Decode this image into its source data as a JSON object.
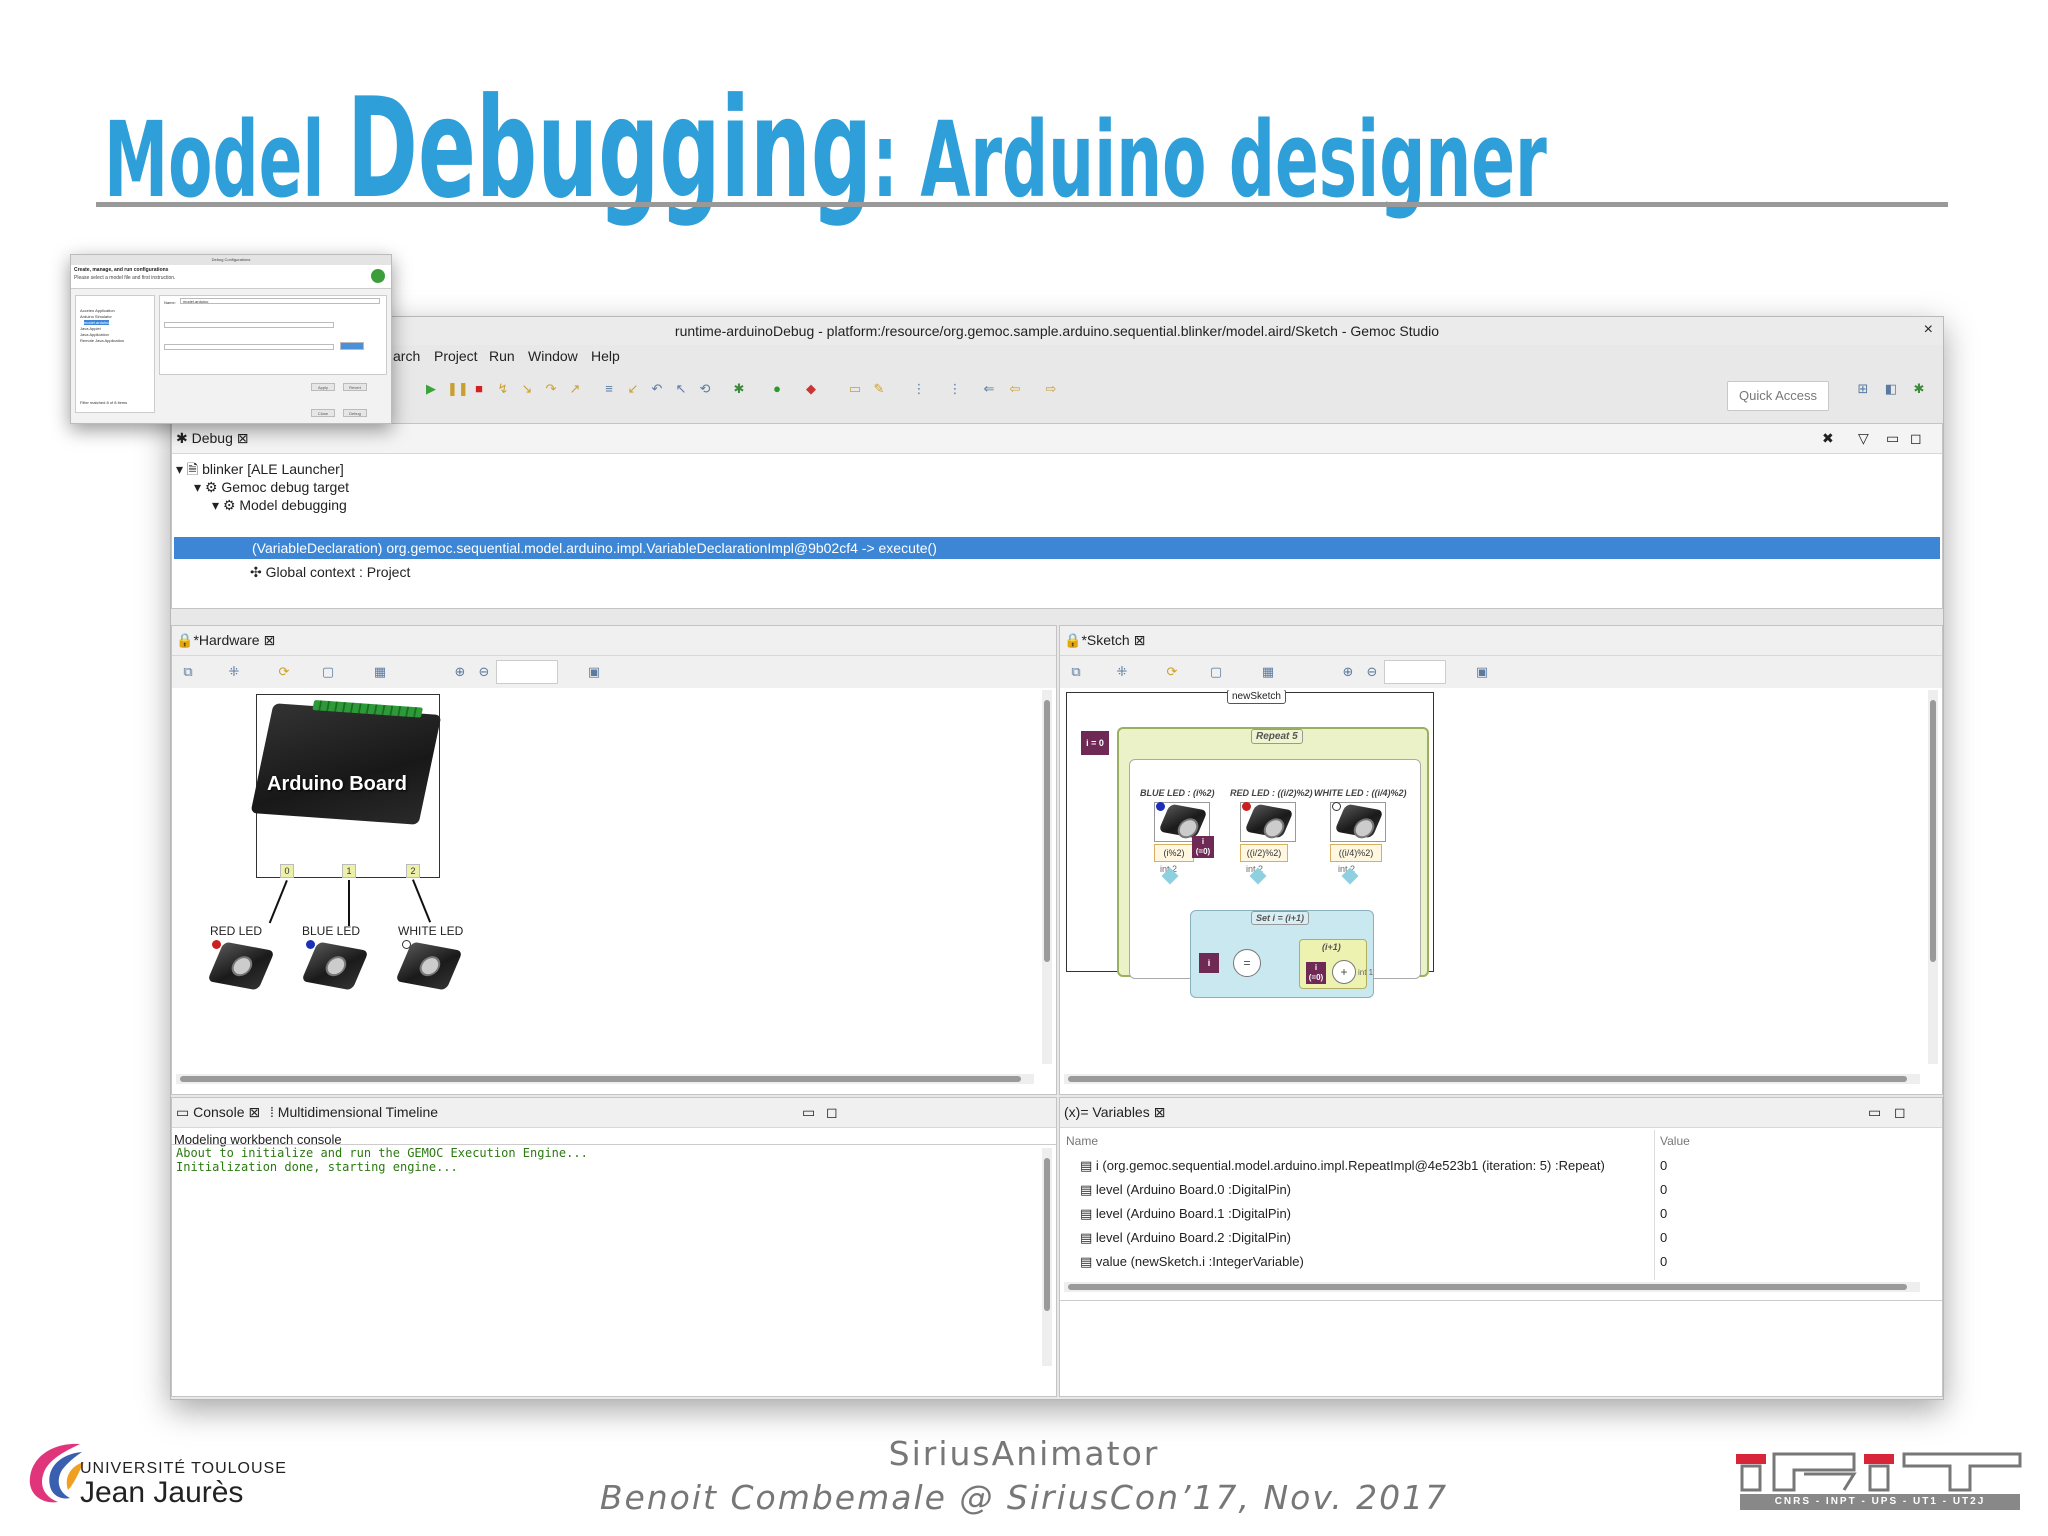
{
  "slide": {
    "title_part1": "Model ",
    "title_part2": "Debugging",
    "title_part3": ": Arduino designer",
    "footer_line1": "SiriusAnimator",
    "footer_line2": "Benoit Combemale @ SiriusCon’17, Nov. 2017",
    "accent_color": "#2e9fd8"
  },
  "window": {
    "title": "runtime-arduinoDebug - platform:/resource/org.gemoc.sample.arduino.sequential.blinker/model.aird/Sketch - Gemoc Studio",
    "close_glyph": "×",
    "menu": [
      "arch",
      "Project",
      "Run",
      "Window",
      "Help"
    ],
    "quick_access": "Quick Access"
  },
  "debug_view": {
    "tab_label": "Debug",
    "tree": [
      "blinker [ALE Launcher]",
      "Gemoc debug target",
      "Model debugging",
      "(VariableDeclaration) org.gemoc.sequential.model.arduino.impl.VariableDeclarationImpl@9b02cf4 -> execute()",
      "Global context : Project"
    ],
    "selection_color": "#3d86d6"
  },
  "hardware_view": {
    "tab_label": "*Hardware",
    "board_label": "Arduino Board",
    "pins": [
      "0",
      "1",
      "2"
    ],
    "leds": [
      {
        "label": "RED LED",
        "color": "#cc1f1f"
      },
      {
        "label": "BLUE LED",
        "color": "#1c2fb8"
      },
      {
        "label": "WHITE LED",
        "color": "#ffffff"
      }
    ]
  },
  "sketch_view": {
    "tab_label": "*Sketch",
    "sketch_name": "newSketch",
    "init_block": "i = 0",
    "repeat_label": "Repeat 5",
    "led_titles": [
      "BLUE LED : (i%2)",
      "RED LED : ((i/2)%2)",
      "WHITE LED : ((i/4)%2)"
    ],
    "led_exprs": [
      "(i%2)",
      "((i/2)%2)",
      "((i/4)%2)"
    ],
    "int_label": "int 2",
    "cond_block": "i\n(=0)",
    "set_label": "Set i = (i+1)",
    "set_var": "i",
    "assign_op": "=",
    "inc_label": "(i+1)",
    "inc_var": "i\n(=0)",
    "plus_op": "+",
    "inc_const": "int 1"
  },
  "console_view": {
    "tab_label": "Console",
    "tab2_label": "Multidimensional Timeline",
    "heading": "Modeling workbench console",
    "lines": "About to initialize and run the GEMOC Execution Engine...\nInitialization done, starting engine..."
  },
  "variables_view": {
    "tab_label": "Variables",
    "col_name": "Name",
    "col_value": "Value",
    "rows": [
      {
        "name": "i (org.gemoc.sequential.model.arduino.impl.RepeatImpl@4e523b1 (iteration: 5) :Repeat)",
        "value": "0"
      },
      {
        "name": "level (Arduino Board.0 :DigitalPin)",
        "value": "0"
      },
      {
        "name": "level (Arduino Board.1 :DigitalPin)",
        "value": "0"
      },
      {
        "name": "level (Arduino Board.2 :DigitalPin)",
        "value": "0"
      },
      {
        "name": "value (newSketch.i :IntegerVariable)",
        "value": "0"
      }
    ]
  },
  "dialog": {
    "title": "Debug Configurations",
    "heading": "Create, manage, and run configurations",
    "subheading": "Please select a model file and first instruction.",
    "name_label": "Name:",
    "name_value": "model.arduino",
    "tree_items": [
      "Acceleo Application",
      "Arduino Simulator",
      "model.arduino",
      "Java Applet",
      "Java Application",
      "Remote Java Application"
    ],
    "filter_text": "Filter matched 8 of 8 items",
    "buttons": [
      "Apply",
      "Revert",
      "Close",
      "Debug"
    ]
  },
  "logos": {
    "ut_line1": "UNIVERSITÉ TOULOUSE",
    "ut_line2": "Jean Jaurès",
    "irit_sub": "CNRS - INPT - UPS - UT1 - UT2J"
  }
}
